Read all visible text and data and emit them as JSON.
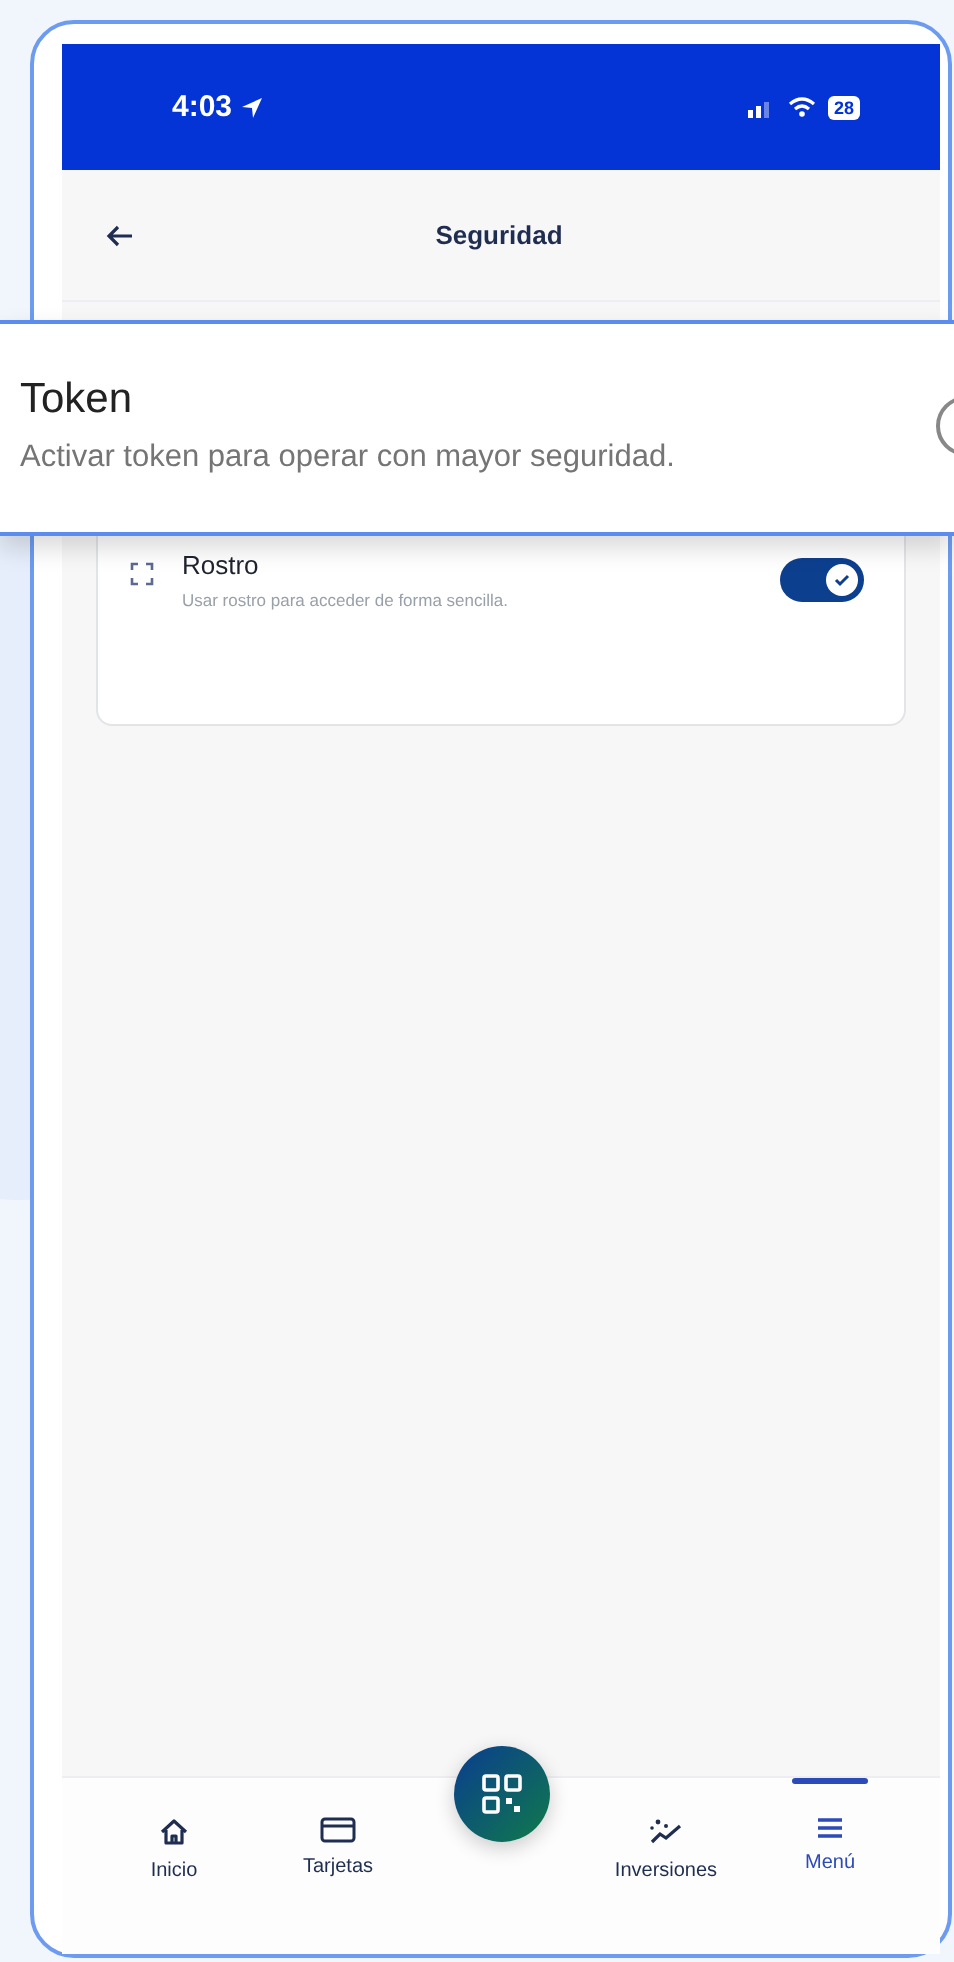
{
  "status_bar": {
    "time": "4:03",
    "battery": "28"
  },
  "header": {
    "title": "Seguridad"
  },
  "callout": {
    "title": "Token",
    "description": "Activar token para operar con mayor seguridad.",
    "on": false
  },
  "options": [
    {
      "title": "Rostro",
      "description": "Usar rostro para acceder de forma sencilla.",
      "on": true
    }
  ],
  "nav": [
    {
      "kind": "home",
      "label": "Inicio",
      "selected": false
    },
    {
      "kind": "card",
      "label": "Tarjetas",
      "selected": false
    },
    {
      "kind": "scan",
      "selected": false
    },
    {
      "kind": "chart",
      "label": "Inversiones",
      "selected": false
    },
    {
      "kind": "menu",
      "label": "Menú",
      "selected": true
    }
  ]
}
